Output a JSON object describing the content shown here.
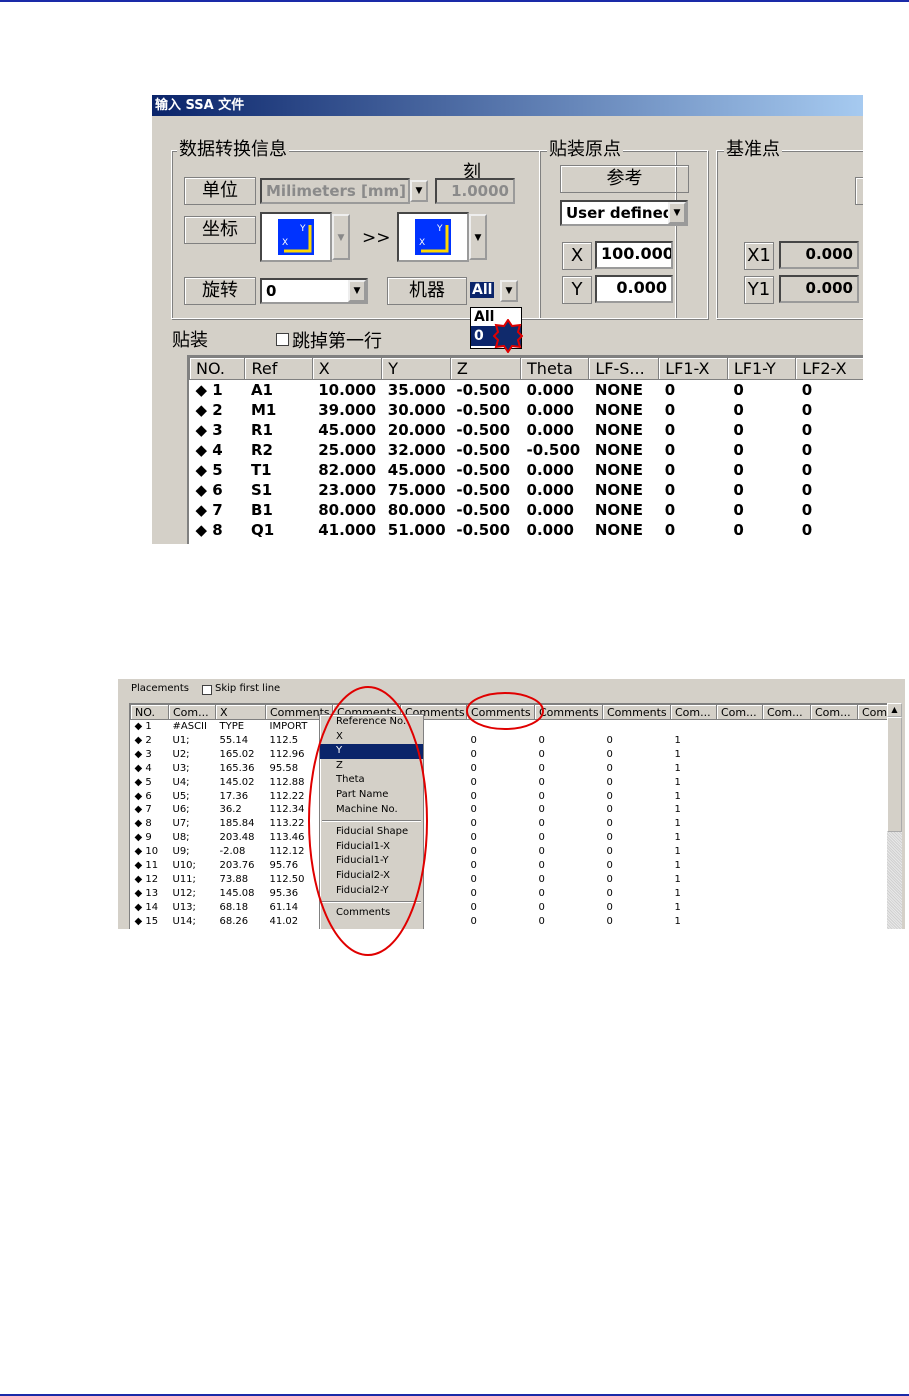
{
  "colors": {
    "rule": "#1a2aa8",
    "highlight": "#0a246a",
    "annotation": "#e00000",
    "axis_icon": "#0033ff"
  },
  "shot1": {
    "title": "输入 SSA 文件",
    "data_group": {
      "label": "数据转换信息",
      "scale_label": "刻",
      "unit_label": "单位",
      "unit_value": "Milimeters [mm]",
      "scale_value": "1.0000",
      "coord_label": "坐标",
      "arrow": ">>",
      "rotate_label": "旋转",
      "rotate_value": "0",
      "machine_label": "机器",
      "machine_value": "All",
      "machine_options": [
        "All",
        "0"
      ]
    },
    "origin_group": {
      "label": "贴装原点",
      "ref_label": "参考",
      "ref_value": "User defined",
      "x_label": "X",
      "x_value": "100.000",
      "y_label": "Y",
      "y_value": "0.000"
    },
    "fiducial_group": {
      "label": "基准点",
      "x1_label": "X1",
      "x1_value": "0.000",
      "y1_label": "Y1",
      "y1_value": "0.000"
    },
    "placement_label": "贴装",
    "skip_label": "跳掉第一行",
    "table": {
      "headers": [
        "NO.",
        "Ref",
        "X",
        "Y",
        "Z",
        "Theta",
        "LF-S...",
        "LF1-X",
        "LF1-Y",
        "LF2-X"
      ],
      "rows": [
        [
          "◆ 1",
          "A1",
          "10.000",
          "35.000",
          "-0.500",
          "0.000",
          "NONE",
          "0",
          "0",
          "0"
        ],
        [
          "◆ 2",
          "M1",
          "39.000",
          "30.000",
          "-0.500",
          "0.000",
          "NONE",
          "0",
          "0",
          "0"
        ],
        [
          "◆ 3",
          "R1",
          "45.000",
          "20.000",
          "-0.500",
          "0.000",
          "NONE",
          "0",
          "0",
          "0"
        ],
        [
          "◆ 4",
          "R2",
          "25.000",
          "32.000",
          "-0.500",
          "-0.500",
          "NONE",
          "0",
          "0",
          "0"
        ],
        [
          "◆ 5",
          "T1",
          "82.000",
          "45.000",
          "-0.500",
          "0.000",
          "NONE",
          "0",
          "0",
          "0"
        ],
        [
          "◆ 6",
          "S1",
          "23.000",
          "75.000",
          "-0.500",
          "0.000",
          "NONE",
          "0",
          "0",
          "0"
        ],
        [
          "◆ 7",
          "B1",
          "80.000",
          "80.000",
          "-0.500",
          "0.000",
          "NONE",
          "0",
          "0",
          "0"
        ],
        [
          "◆ 8",
          "Q1",
          "41.000",
          "51.000",
          "-0.500",
          "0.000",
          "NONE",
          "0",
          "0",
          "0"
        ]
      ]
    }
  },
  "shot2": {
    "placements_label": "Placements",
    "skip_label": "Skip first line",
    "headers": [
      "NO.",
      "Com...",
      "X",
      "Comments",
      "Comments",
      "Comments",
      "Comments",
      "Comments",
      "Comments",
      "Com...",
      "Com...",
      "Com...",
      "Com...",
      "Com"
    ],
    "rows": [
      [
        "◆ 1",
        "#ASCII",
        "TYPE",
        "IMPORT",
        "",
        "",
        "",
        "",
        "",
        "",
        ""
      ],
      [
        "◆ 2",
        "U1;",
        "55.14",
        "112.5",
        "",
        "0",
        "0",
        "0",
        "0",
        "1",
        ""
      ],
      [
        "◆ 3",
        "U2;",
        "165.02",
        "112.96",
        "",
        "0",
        "0",
        "0",
        "0",
        "1",
        ""
      ],
      [
        "◆ 4",
        "U3;",
        "165.36",
        "95.58",
        "",
        "0",
        "0",
        "0",
        "0",
        "1",
        ""
      ],
      [
        "◆ 5",
        "U4;",
        "145.02",
        "112.88",
        "",
        "0",
        "0",
        "0",
        "0",
        "1",
        ""
      ],
      [
        "◆ 6",
        "U5;",
        "17.36",
        "112.22",
        "",
        "0",
        "0",
        "0",
        "0",
        "1",
        ""
      ],
      [
        "◆ 7",
        "U6;",
        "36.2",
        "112.34",
        "",
        "0",
        "0",
        "0",
        "0",
        "1",
        ""
      ],
      [
        "◆ 8",
        "U7;",
        "185.84",
        "113.22",
        "",
        "0",
        "0",
        "0",
        "0",
        "1",
        ""
      ],
      [
        "◆ 9",
        "U8;",
        "203.48",
        "113.46",
        "",
        "0",
        "0",
        "0",
        "0",
        "1",
        ""
      ],
      [
        "◆ 10",
        "U9;",
        "-2.08",
        "112.12",
        "",
        "0",
        "0",
        "0",
        "0",
        "1",
        ""
      ],
      [
        "◆ 11",
        "U10;",
        "203.76",
        "95.76",
        "",
        "0",
        "0",
        "0",
        "0",
        "1",
        ""
      ],
      [
        "◆ 12",
        "U11;",
        "73.88",
        "112.50",
        "",
        "0",
        "0",
        "0",
        "0",
        "1",
        ""
      ],
      [
        "◆ 13",
        "U12;",
        "145.08",
        "95.36",
        "",
        "0",
        "0",
        "0",
        "0",
        "1",
        ""
      ],
      [
        "◆ 14",
        "U13;",
        "68.18",
        "61.14",
        "",
        "0",
        "0",
        "0",
        "0",
        "1",
        ""
      ],
      [
        "◆ 15",
        "U14;",
        "68.26",
        "41.02",
        "",
        "0",
        "0",
        "0",
        "0",
        "1",
        ""
      ]
    ],
    "menu_items": [
      "Reference No.",
      "X",
      "Y",
      "Z",
      "Theta",
      "Part Name",
      "Machine No.",
      "Fiducial Shape",
      "Fiducial1-X",
      "Fiducial1-Y",
      "Fiducial2-X",
      "Fiducial2-Y",
      "Comments"
    ],
    "menu_selected": "Y"
  }
}
